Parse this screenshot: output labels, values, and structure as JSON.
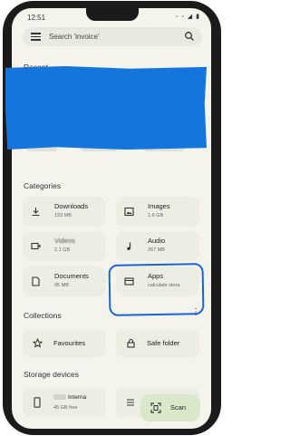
{
  "status_bar": {
    "time": "12:51",
    "icons": "◦ ◦ ◢ ▮"
  },
  "search": {
    "text": "Search 'invoice'"
  },
  "recent": {
    "title": "Recent"
  },
  "categories": {
    "title": "Categories",
    "items": [
      {
        "name": "Downloads",
        "sub": "193 MB",
        "icon": "download-icon"
      },
      {
        "name": "Images",
        "sub": "1.6 GB",
        "icon": "image-icon"
      },
      {
        "name": "Videos",
        "sub": "2.1 GB",
        "icon": "video-icon"
      },
      {
        "name": "Audio",
        "sub": "267 MB",
        "icon": "music-note-icon"
      },
      {
        "name": "Documents",
        "sub": "95 MB",
        "icon": "document-icon"
      },
      {
        "name": "Apps",
        "sub": "calculate stora",
        "icon": "apps-icon"
      }
    ]
  },
  "collections": {
    "title": "Collections",
    "more": "⋮",
    "items": [
      {
        "label": "Favourites",
        "icon": "star-icon"
      },
      {
        "label": "Safe folder",
        "icon": "lock-icon"
      }
    ]
  },
  "storage": {
    "title": "Storage devices",
    "items": [
      {
        "name": "Interna",
        "sub": "45 GB free",
        "icon": "phone-icon"
      },
      {
        "name": "",
        "sub": "",
        "icon": "list-icon"
      }
    ]
  },
  "scan": {
    "label": "Scan",
    "icon": "scan-icon"
  },
  "colors": {
    "accent_green": "#d9e8c9",
    "redaction_blue": "#1476dc",
    "highlight_blue": "#1a63d8"
  }
}
